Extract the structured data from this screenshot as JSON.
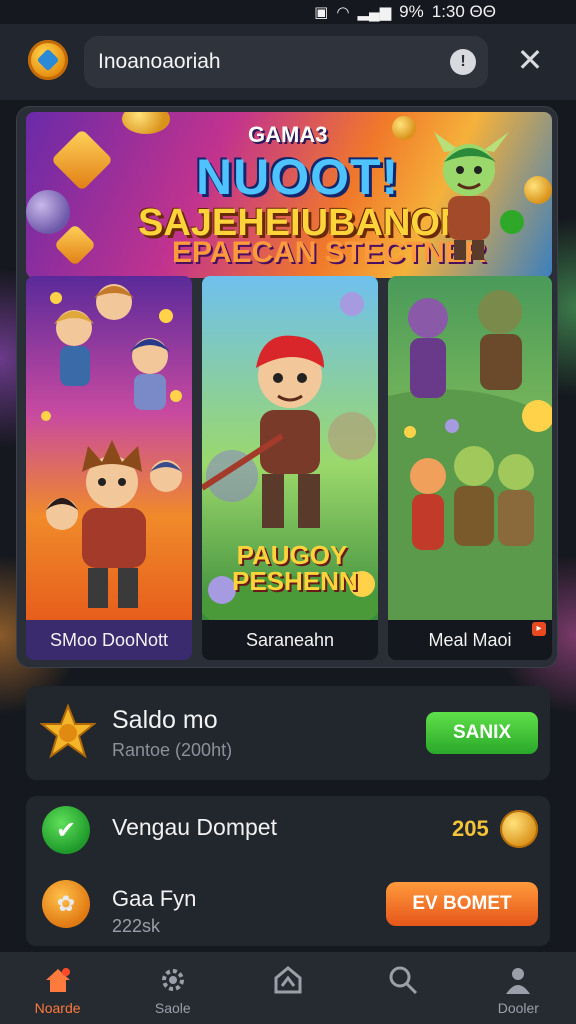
{
  "status_bar": {
    "battery": "9%",
    "time": "1:30 ΘΘ"
  },
  "header": {
    "search_value": "Inoanoaoriah",
    "search_badge": "!"
  },
  "banner": {
    "tag": "GAMA3",
    "title_line1": "NUOOT!",
    "title_line2": "SAJEHEIUBANON",
    "title_line3": "EPAECAN STECTNER"
  },
  "tiles": [
    {
      "label": "SMoo DooNott"
    },
    {
      "label": "Saraneahn",
      "overlay": "PAUGOY PESHENN"
    },
    {
      "label": "Meal Maoi"
    }
  ],
  "balance": {
    "title": "Saldo mo",
    "subtitle": "Rantoe (200ht)",
    "button": "SANIX"
  },
  "wallet": {
    "title": "Vengau Dompet",
    "amount": "205"
  },
  "gift": {
    "title": "Gaa Fyn",
    "subtitle": "222sk",
    "button": "EV BOMET"
  },
  "nav": [
    {
      "label": "Noarde",
      "icon": "home-icon",
      "active": true
    },
    {
      "label": "Saole",
      "icon": "gear-icon"
    },
    {
      "label": "",
      "icon": "upload-icon"
    },
    {
      "label": "",
      "icon": "search-icon"
    },
    {
      "label": "Dooler",
      "icon": "profile-icon"
    }
  ],
  "colors": {
    "accent_orange": "#ff7a3c",
    "green_button": "#3cc83a",
    "coin_gold": "#f3c33a"
  }
}
